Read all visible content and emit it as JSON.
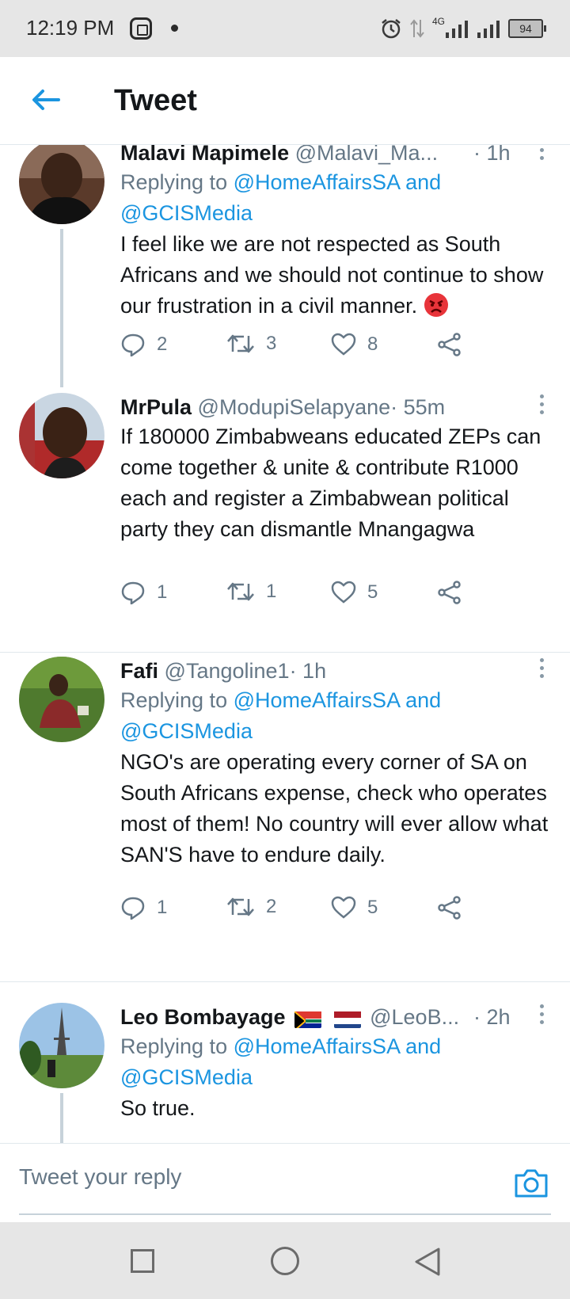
{
  "status_bar": {
    "time": "12:19 PM",
    "network": "4G",
    "battery": "94"
  },
  "header": {
    "title": "Tweet"
  },
  "tweets": [
    {
      "name": "Malavi Mapimele",
      "handle": "@Malavi_Ma...",
      "time": "· 1h",
      "replying_prefix": "Replying to ",
      "reply_mention_1": "@HomeAffairsSA",
      "reply_and": " and",
      "reply_mention_2": "@GCISMedia",
      "text": "I feel like we are not respected as South Africans and we should not continue to show our frustration in a civil manner.",
      "emoji": "angry-face",
      "replies": "2",
      "retweets": "3",
      "likes": "8"
    },
    {
      "name": "MrPula",
      "handle": "@ModupiSelapyane",
      "time": "· 55m",
      "text": "If 180000 Zimbabweans educated ZEPs can come together & unite & contribute R1000 each and register a Zimbabwean political party they can dismantle Mnangagwa",
      "replies": "1",
      "retweets": "1",
      "likes": "5"
    },
    {
      "name": "Fafi",
      "handle": "@Tangoline1",
      "time": "· 1h",
      "replying_prefix": "Replying to ",
      "reply_mention_1": "@HomeAffairsSA",
      "reply_and": " and",
      "reply_mention_2": "@GCISMedia",
      "text": "NGO's are operating every corner of SA on South Africans expense, check who operates most of them! No country will ever allow what SAN'S have to endure daily.",
      "replies": "1",
      "retweets": "2",
      "likes": "5"
    },
    {
      "name": "Leo Bombayage",
      "flags": [
        "south-africa-flag",
        "netherlands-flag"
      ],
      "handle": "@LeoB...",
      "time": "· 2h",
      "replying_prefix": "Replying to ",
      "reply_mention_1": "@HomeAffairsSA",
      "reply_and": " and",
      "reply_mention_2": "@GCISMedia",
      "text": "So true."
    }
  ],
  "reply_bar": {
    "placeholder": "Tweet your reply"
  },
  "colors": {
    "accent": "#1b95e0",
    "muted": "#657786",
    "text": "#14171a"
  }
}
